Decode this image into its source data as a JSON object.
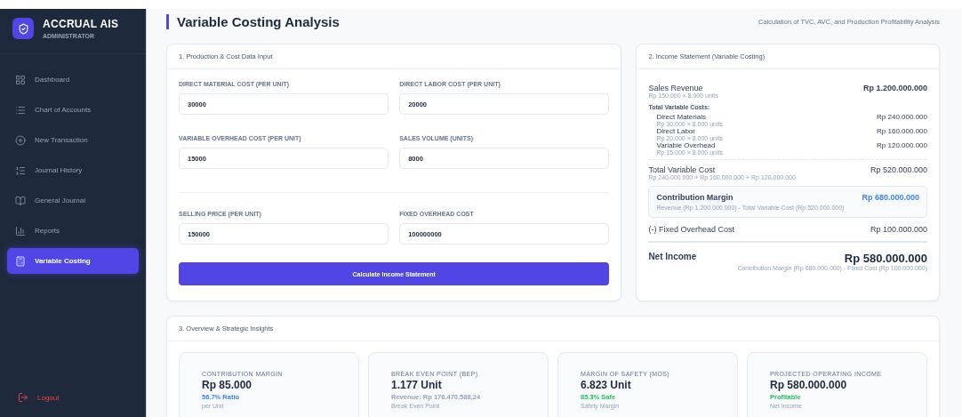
{
  "sidebar": {
    "brand": "ACCRUAL AIS",
    "role": "ADMINISTRATOR",
    "items": [
      {
        "label": "Dashboard",
        "selected": false
      },
      {
        "label": "Chart of Accounts",
        "selected": false
      },
      {
        "label": "New Transaction",
        "selected": false
      },
      {
        "label": "Journal History",
        "selected": false
      },
      {
        "label": "General Journal",
        "selected": false
      },
      {
        "label": "Reports",
        "selected": false
      },
      {
        "label": "Variable Costing",
        "selected": true
      }
    ],
    "logout": "Logout"
  },
  "header": {
    "title": "Variable Costing Analysis",
    "subtitle": "Calculation of TVC, AVC, and Production Profitability Analysis"
  },
  "input_card": {
    "title": "1. Production & Cost Data Input",
    "groups": [
      {
        "fields": [
          {
            "label": "DIRECT MATERIAL COST (PER UNIT)",
            "value": "30000"
          },
          {
            "label": "DIRECT LABOR COST (PER UNIT)",
            "value": "20000"
          },
          {
            "label": "VARIABLE OVERHEAD COST (PER UNIT)",
            "value": "15000"
          },
          {
            "label": "SALES VOLUME (UNITS)",
            "value": "8000"
          }
        ]
      },
      {
        "fields": [
          {
            "label": "SELLING PRICE (PER UNIT)",
            "value": "150000"
          },
          {
            "label": "FIXED OVERHEAD COST",
            "value": "100000000"
          }
        ]
      }
    ],
    "button": "Calculate Income Statement"
  },
  "income_card": {
    "title": "2. Income Statement (Variable Costing)",
    "sales": {
      "label": "Sales Revenue",
      "detail": "Rp 150.000 × 8.000 units",
      "amount": "Rp 1.200.000.000"
    },
    "variable_heading": "Total Variable Costs:",
    "variable_items": [
      {
        "label": "Direct Materials",
        "detail": "Rp 30.000 × 8.000 units",
        "amount": "Rp 240.000.000"
      },
      {
        "label": "Direct Labor",
        "detail": "Rp 20.000 × 8.000 units",
        "amount": "Rp 160.000.000"
      },
      {
        "label": "Variable Overhead",
        "detail": "Rp 15.000 × 8.000 units",
        "amount": "Rp 120.000.000"
      }
    ],
    "total_variable": {
      "label": "Total Variable Cost",
      "detail": "Rp 240.000.000 + Rp 160.000.000 + Rp 120.000.000",
      "amount": "Rp 520.000.000"
    },
    "contribution": {
      "label": "Contribution Margin",
      "detail": "Revenue (Rp 1.200.000.000) - Total Variable Cost (Rp 520.000.000)",
      "amount": "Rp 680.000.000"
    },
    "fixed": {
      "label": "(-) Fixed Overhead Cost",
      "amount": "Rp 100.000.000"
    },
    "net": {
      "label": "Net Income",
      "amount": "Rp 580.000.000",
      "detail": "Contribution Margin (Rp 680.000.000) - Fixed Cost (Rp 100.000.000)"
    }
  },
  "insights": {
    "title": "3. Overview & Strategic Insights",
    "cards": [
      {
        "label": "CONTRIBUTION MARGIN",
        "value": "Rp 85.000",
        "note": "56.7% Ratio",
        "color": "#3b82f6",
        "caption": "per Unit"
      },
      {
        "label": "BREAK EVEN POINT (BEP)",
        "value": "1.177 Unit",
        "note": "Revenue: Rp 176.470.588,24",
        "color": "#94a3b8",
        "caption": "Break Even Point"
      },
      {
        "label": "MARGIN OF SAFETY (MOS)",
        "value": "6.823 Unit",
        "note": "85.3% Safe",
        "color": "#22c55e",
        "caption": "Safety Margin"
      },
      {
        "label": "PROJECTED OPERATING INCOME",
        "value": "Rp 580.000.000",
        "note": "Profitable",
        "color": "#22c55e",
        "caption": "Net Income"
      }
    ]
  }
}
